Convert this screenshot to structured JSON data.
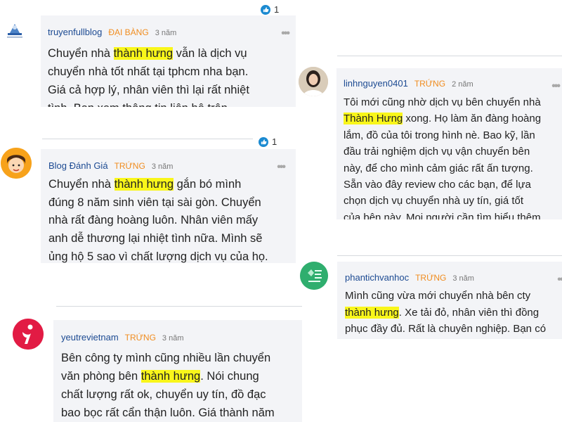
{
  "highlight_color": "#f9f61a",
  "accent": {
    "author": "#1c4a92",
    "tag": "#f08c1e"
  },
  "comments": [
    {
      "author": "truyenfullblog",
      "tag": "ĐẠI BÀNG",
      "time": "3 năm",
      "avatar": "truyenfullblog-logo",
      "lines": [
        [
          "Chuyển nhà ",
          {
            "hl": "thành hưng"
          },
          " vẫn là dịch vụ"
        ],
        [
          "chuyển nhà tốt nhất tại tphcm nha bạn."
        ],
        [
          "Giá cả hợp lý, nhân viên thì lại rất nhiệt"
        ],
        [
          "tình. Bạn xem thông tin liên hệ trên"
        ]
      ],
      "reaction_count": "1"
    },
    {
      "author": "linhnguyen0401",
      "tag": "TRỨNG",
      "time": "2 năm",
      "avatar": "woman-photo",
      "lines": [
        [
          "Tôi mới cũng nhờ dịch vụ bên chuyển nhà"
        ],
        [
          {
            "hl": "Thành Hưng"
          },
          " xong. Họ làm ăn đàng hoàng"
        ],
        [
          "lắm, đồ của tôi trong hình nè. Bao kỹ, lần"
        ],
        [
          "đầu trải nghiệm dịch vụ vận chuyển bên"
        ],
        [
          "này, để cho mình cảm giác rất ấn tượng."
        ],
        [
          "Sẵn vào đây review cho các bạn, để lựa"
        ],
        [
          "chọn dịch vụ chuyển nhà uy tín, giá tốt"
        ],
        [
          "của bên này. Mọi người cần tìm hiểu thêm"
        ]
      ]
    },
    {
      "author": "Blog Đánh Giá",
      "tag": "TRỨNG",
      "time": "3 năm",
      "avatar": "cartoon-boy-avatar",
      "lines": [
        [
          "Chuyển nhà ",
          {
            "hl": "thành hưng"
          },
          " gắn bó mình"
        ],
        [
          "đúng 8 năm sinh viên tại sài gòn. Chuyển"
        ],
        [
          "nhà rất đàng hoàng luôn. Nhân viên mấy"
        ],
        [
          "anh dễ thương lại nhiệt tình nữa. Mình sẽ"
        ],
        [
          "ủng hộ 5 sao vì chất lượng dịch vụ của họ."
        ]
      ],
      "reaction_count": "1"
    },
    {
      "author": "phantichvanhoc",
      "tag": "TRỨNG",
      "time": "3 năm",
      "avatar": "phantichvanhoc-logo",
      "lines": [
        [
          "Mình cũng vừa mới chuyển nhà bên cty"
        ],
        [
          {
            "hl": "thành hưng"
          },
          ". Xe tải đỏ, nhân viên thì đồng"
        ],
        [
          "phục đầy đủ. Rất là chuyên nghiệp. Bạn có"
        ]
      ]
    },
    {
      "author": "yeutrevietnam",
      "tag": "TRỨNG",
      "time": "3 năm",
      "avatar": "yeutrevietnam-logo",
      "lines": [
        [
          "Bên công ty mình cũng nhiều lần chuyển"
        ],
        [
          "văn phòng bên ",
          {
            "hl": "thành hưng"
          },
          ". Nói chung"
        ],
        [
          "chất lượng rất ok, chuyển uy tín, đồ đạc"
        ],
        [
          "bao bọc rất cẩn thận luôn. Giá thành năm"
        ]
      ]
    }
  ]
}
